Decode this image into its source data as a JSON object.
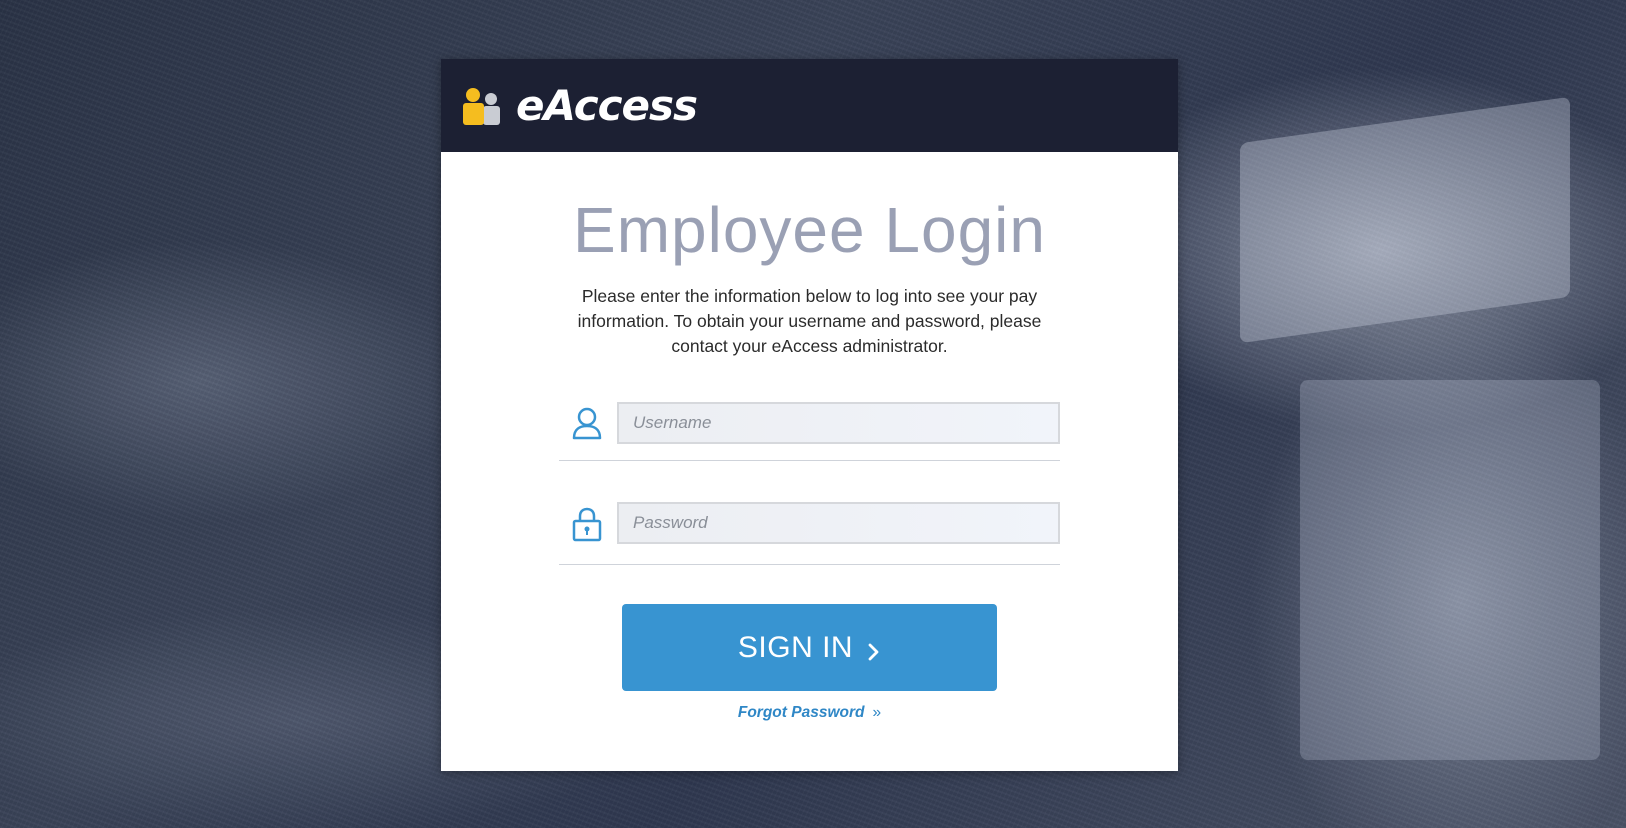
{
  "brand": {
    "name": "eAccess",
    "logo_colors": {
      "primary": "#f5bd1f",
      "secondary": "#c9ccd3"
    }
  },
  "login": {
    "title": "Employee Login",
    "instructions": "Please enter the information below to log into see your pay information. To obtain your username and password, please contact your eAccess administrator.",
    "username": {
      "placeholder": "Username",
      "value": "",
      "icon": "user-icon"
    },
    "password": {
      "placeholder": "Password",
      "value": "",
      "icon": "lock-icon"
    },
    "submit_label": "SIGN IN",
    "submit_icon": "chevron-right-icon",
    "forgot_label": "Forgot Password",
    "forgot_icon": "double-chevron-right-icon"
  },
  "colors": {
    "header_bg": "#1c2033",
    "accent": "#3894d1",
    "heading_text": "#9aa0b4"
  }
}
